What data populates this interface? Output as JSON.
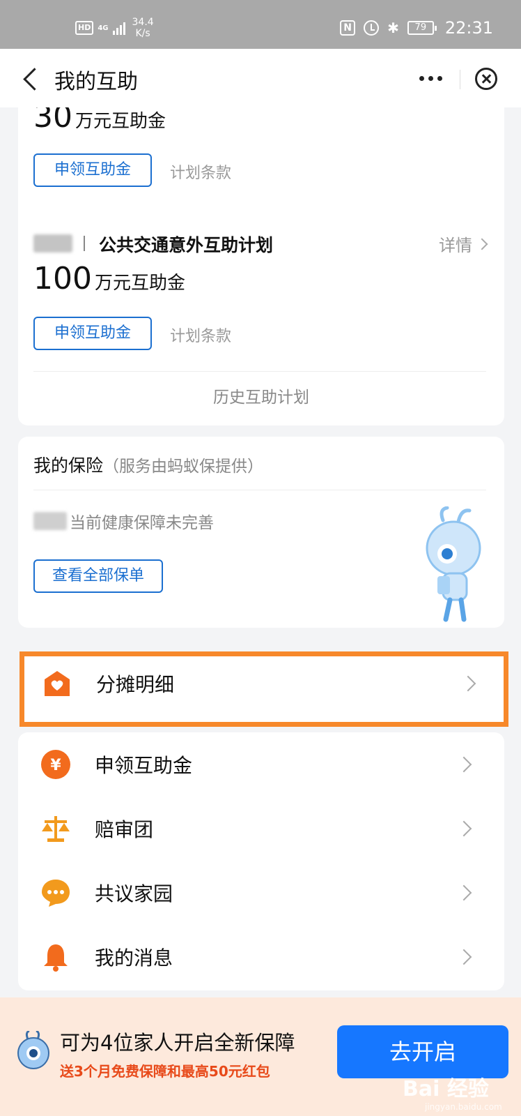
{
  "status_bar": {
    "hd": "HD",
    "network": "4G",
    "speed_value": "34.4",
    "speed_unit": "K/s",
    "nfc": "N",
    "battery": "79",
    "time": "22:31"
  },
  "nav": {
    "title": "我的互助"
  },
  "plans": [
    {
      "amount": "30",
      "unit": "万元互助金",
      "claim_label": "申领互助金",
      "terms_label": "计划条款"
    },
    {
      "name": "公共交通意外互助计划",
      "detail_label": "详情",
      "amount": "100",
      "unit": "万元互助金",
      "claim_label": "申领互助金",
      "terms_label": "计划条款"
    }
  ],
  "history_label": "历史互助计划",
  "insurance": {
    "title": "我的保险",
    "subtitle": "（服务由蚂蚁保提供）",
    "health_text": "当前健康保障未完善",
    "view_all_label": "查看全部保单"
  },
  "menu": {
    "highlighted": {
      "label": "分摊明细",
      "icon": "house-heart-icon"
    },
    "items": [
      {
        "label": "申领互助金",
        "icon": "yen-coin-icon"
      },
      {
        "label": "赔审团",
        "icon": "scale-icon"
      },
      {
        "label": "共议家园",
        "icon": "chat-bubble-icon"
      },
      {
        "label": "我的消息",
        "icon": "bell-icon"
      }
    ]
  },
  "banner": {
    "main": "可为4位家人开启全新保障",
    "sub": "送3个月免费保障和最高50元红包",
    "cta": "去开启"
  },
  "watermark": {
    "brand": "Bai 经验",
    "url": "jingyan.baidu.com"
  },
  "colors": {
    "accent_blue": "#1b6fd0",
    "cta_blue": "#1677ff",
    "icon_orange": "#f26b1d",
    "highlight_orange": "#f7882a",
    "banner_bg": "#fde9dc",
    "banner_sub_red": "#e84a1a"
  }
}
